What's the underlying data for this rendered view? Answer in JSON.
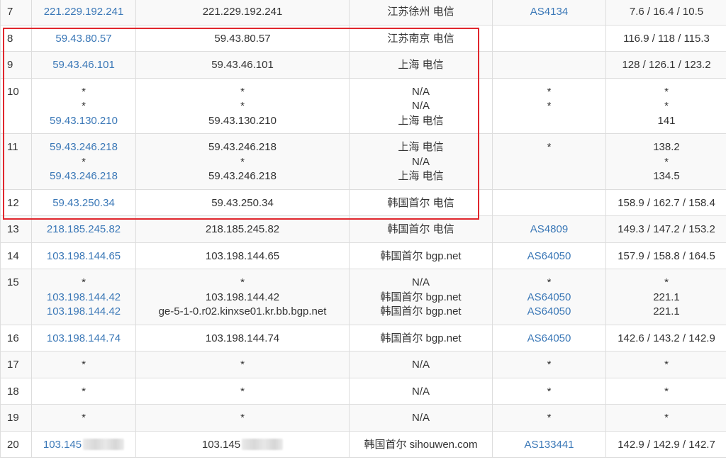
{
  "colors": {
    "link": "#3b78b7",
    "text": "#333333",
    "border": "#dddddd",
    "highlight": "#e0272d",
    "row_alt": "#f9f9f9"
  },
  "rows": [
    {
      "hop": "7",
      "ip": [
        "221.229.192.241"
      ],
      "host": [
        "221.229.192.241"
      ],
      "loc": [
        "江苏徐州 电信"
      ],
      "as": [
        "AS4134"
      ],
      "time": [
        "7.6 / 16.4 / 10.5"
      ]
    },
    {
      "hop": "8",
      "ip": [
        "59.43.80.57"
      ],
      "host": [
        "59.43.80.57"
      ],
      "loc": [
        "江苏南京 电信"
      ],
      "as": [
        ""
      ],
      "time": [
        "116.9 / 118 / 115.3"
      ]
    },
    {
      "hop": "9",
      "ip": [
        "59.43.46.101"
      ],
      "host": [
        "59.43.46.101"
      ],
      "loc": [
        "上海 电信"
      ],
      "as": [
        ""
      ],
      "time": [
        "128 / 126.1 / 123.2"
      ]
    },
    {
      "hop": "10",
      "ip": [
        "*",
        "*",
        "59.43.130.210"
      ],
      "host": [
        "*",
        "*",
        "59.43.130.210"
      ],
      "loc": [
        "N/A",
        "N/A",
        "上海 电信"
      ],
      "as": [
        "*",
        "*"
      ],
      "time": [
        "*",
        "*",
        "141"
      ]
    },
    {
      "hop": "11",
      "ip": [
        "59.43.246.218",
        "*",
        "59.43.246.218"
      ],
      "host": [
        "59.43.246.218",
        "*",
        "59.43.246.218"
      ],
      "loc": [
        "上海 电信",
        "N/A",
        "上海 电信"
      ],
      "as": [
        "",
        "*"
      ],
      "time": [
        "138.2",
        "*",
        "134.5"
      ]
    },
    {
      "hop": "12",
      "ip": [
        "59.43.250.34"
      ],
      "host": [
        "59.43.250.34"
      ],
      "loc": [
        "韩国首尔 电信"
      ],
      "as": [
        ""
      ],
      "time": [
        "158.9 / 162.7 / 158.4"
      ]
    },
    {
      "hop": "13",
      "ip": [
        "218.185.245.82"
      ],
      "host": [
        "218.185.245.82"
      ],
      "loc": [
        "韩国首尔 电信"
      ],
      "as": [
        "AS4809"
      ],
      "time": [
        "149.3 / 147.2 / 153.2"
      ]
    },
    {
      "hop": "14",
      "ip": [
        "103.198.144.65"
      ],
      "host": [
        "103.198.144.65"
      ],
      "loc": [
        "韩国首尔 bgp.net"
      ],
      "as": [
        "AS64050"
      ],
      "time": [
        "157.9 / 158.8 / 164.5"
      ]
    },
    {
      "hop": "15",
      "ip": [
        "*",
        "103.198.144.42",
        "103.198.144.42"
      ],
      "host": [
        "*",
        "103.198.144.42",
        "ge-5-1-0.r02.kinxse01.kr.bb.bgp.net"
      ],
      "loc": [
        "N/A",
        "韩国首尔 bgp.net",
        "韩国首尔 bgp.net"
      ],
      "as": [
        "*",
        "AS64050",
        "AS64050"
      ],
      "time": [
        "*",
        "221.1",
        "221.1"
      ]
    },
    {
      "hop": "16",
      "ip": [
        "103.198.144.74"
      ],
      "host": [
        "103.198.144.74"
      ],
      "loc": [
        "韩国首尔 bgp.net"
      ],
      "as": [
        "AS64050"
      ],
      "time": [
        "142.6 / 143.2 / 142.9"
      ]
    },
    {
      "hop": "17",
      "ip": [
        "*"
      ],
      "host": [
        "*"
      ],
      "loc": [
        "N/A"
      ],
      "as": [
        "*"
      ],
      "time": [
        "*"
      ]
    },
    {
      "hop": "18",
      "ip": [
        "*"
      ],
      "host": [
        "*"
      ],
      "loc": [
        "N/A"
      ],
      "as": [
        "*"
      ],
      "time": [
        "*"
      ]
    },
    {
      "hop": "19",
      "ip": [
        "*"
      ],
      "host": [
        "*"
      ],
      "loc": [
        "N/A"
      ],
      "as": [
        "*"
      ],
      "time": [
        "*"
      ]
    },
    {
      "hop": "20",
      "ip": [
        "103.145"
      ],
      "host": [
        "103.145"
      ],
      "loc": [
        "韩国首尔 sihouwen.com"
      ],
      "as": [
        "AS133441"
      ],
      "time": [
        "142.9 / 142.9 / 142.7"
      ]
    }
  ]
}
